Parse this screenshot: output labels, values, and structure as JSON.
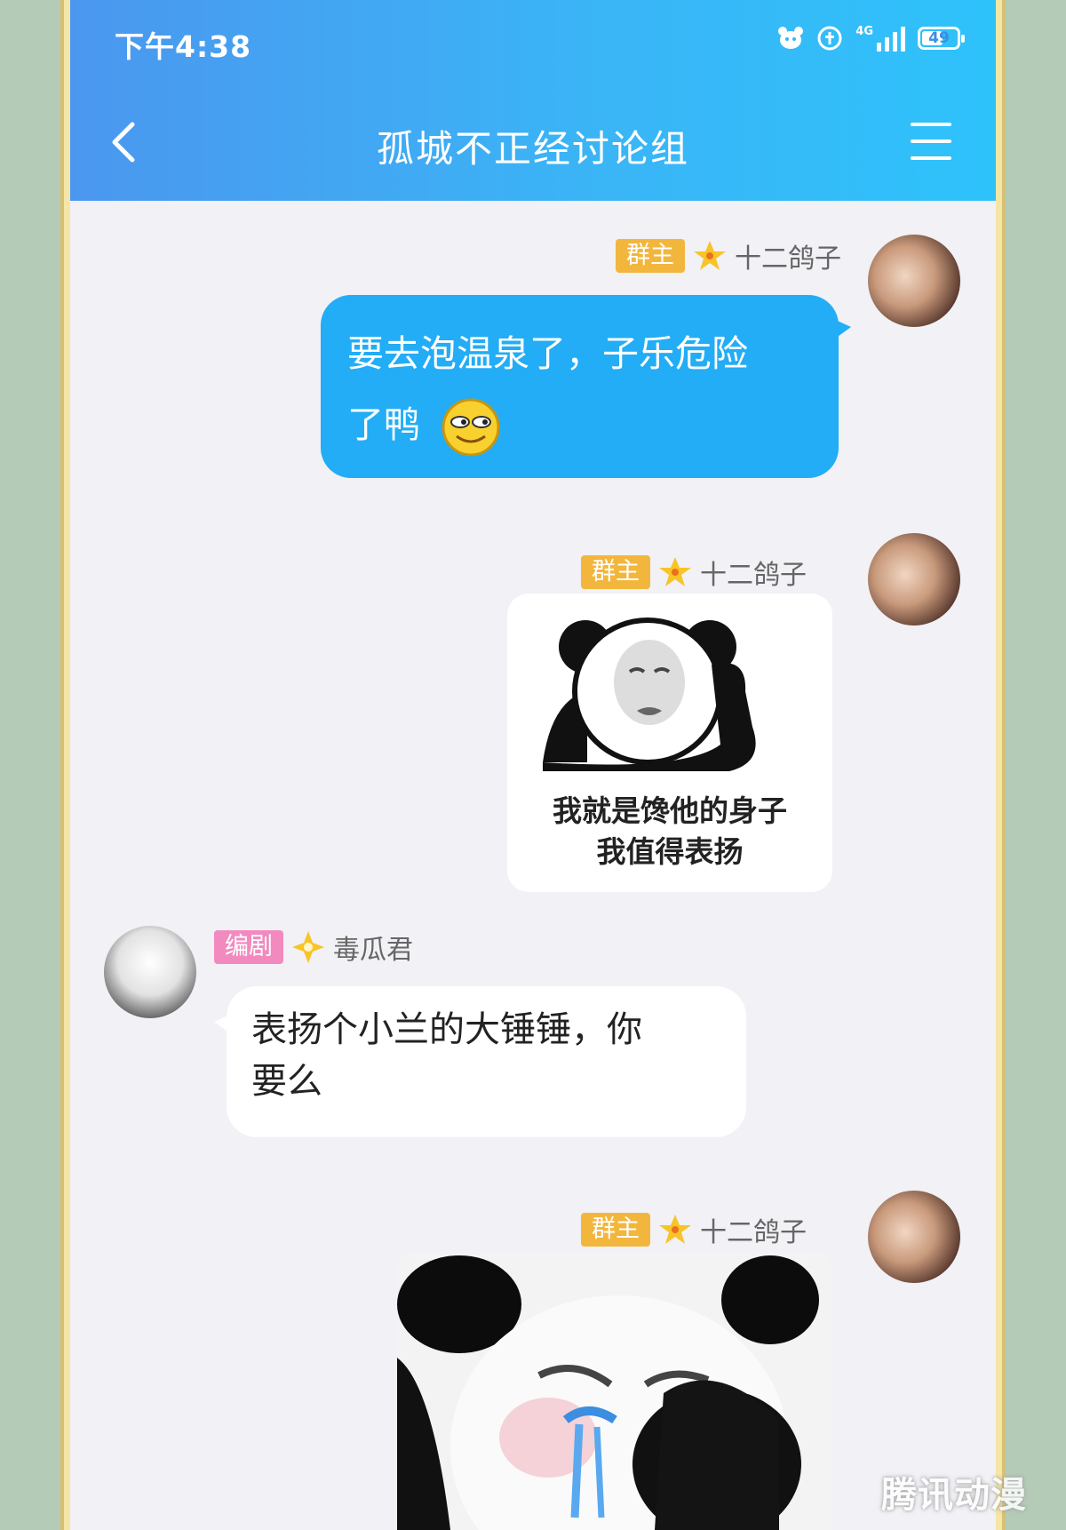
{
  "status_bar": {
    "time": "下午4:38",
    "network": "4G",
    "battery": "49"
  },
  "header": {
    "title": "孤城不正经讨论组"
  },
  "messages": [
    {
      "badge": "群主",
      "sender": "十二鸽子",
      "text_line1": "要去泡温泉了，子乐危险",
      "text_line2": "了鸭"
    },
    {
      "badge": "群主",
      "sender": "十二鸽子",
      "sticker_caption_line1": "我就是馋他的身子",
      "sticker_caption_line2": "我值得表扬"
    },
    {
      "badge": "编剧",
      "sender": "毒瓜君",
      "text_line1": "表扬个小兰的大锤锤，你",
      "text_line2": "要么"
    },
    {
      "badge": "群主",
      "sender": "十二鸽子"
    }
  ],
  "watermark": "腾讯动漫",
  "colors": {
    "header_start": "#4b97ef",
    "header_end": "#2ec2fb",
    "owner_badge": "#f3b63d",
    "writer_badge": "#f28ac0",
    "my_bubble": "#22adf6"
  }
}
